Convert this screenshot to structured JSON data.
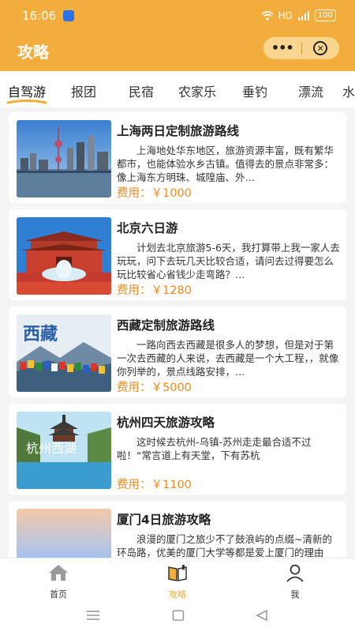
{
  "status_bar": {
    "time": "16:06",
    "network": "HD",
    "battery": "100"
  },
  "header": {
    "title": "攻略",
    "more_label": "•••"
  },
  "tabs": [
    {
      "label": "自驾游",
      "active": true
    },
    {
      "label": "报团",
      "active": false
    },
    {
      "label": "民宿",
      "active": false
    },
    {
      "label": "农家乐",
      "active": false
    },
    {
      "label": "垂钓",
      "active": false
    },
    {
      "label": "漂流",
      "active": false
    },
    {
      "label": "水",
      "active": false
    }
  ],
  "cards": [
    {
      "title": "上海两日定制旅游路线",
      "desc": "上海地处华东地区，旅游资源丰富，既有繁华都市，也能体验水乡古镇。值得去的景点非常多：像上海东方明珠、城隍庙、外…",
      "price": "费用：￥1000",
      "image": "shanghai-skyline"
    },
    {
      "title": "北京六日游",
      "desc": "计划去北京旅游5-6天，我打算带上我一家人去玩玩，问下去玩几天比较合适，请问去过得要怎么玩比较省心省钱少走弯路？…",
      "price": "费用：￥1280",
      "image": "beijing-tiananmen"
    },
    {
      "title": "西藏定制旅游路线",
      "desc": "一路向西去西藏是很多人的梦想，但是对于第一次去西藏的人来说，去西藏是一个大工程，，就像你列举的，景点线路安排，…",
      "price": "费用：￥5000",
      "image": "tibet-prayer-flags",
      "image_caption": "西藏"
    },
    {
      "title": "杭州四天旅游攻略",
      "desc": "这时候去杭州-乌镇-苏州走走最合适不过啦！“常言道上有天堂，下有苏杭",
      "price": "费用：￥1100",
      "image": "hangzhou-west-lake",
      "image_caption": "杭州西湖"
    },
    {
      "title": "厦门4日旅游攻略",
      "desc": "浪漫的厦门之旅少不了鼓浪屿的点缀~清新的环岛路，优美的厦门大学等都是爱上厦门的理由",
      "price": "",
      "image": "xiamen-sky"
    }
  ],
  "bottom_nav": [
    {
      "label": "首页",
      "icon": "home-icon",
      "active": false
    },
    {
      "label": "攻略",
      "icon": "book-icon",
      "active": true
    },
    {
      "label": "我",
      "icon": "person-icon",
      "active": false
    }
  ],
  "colors": {
    "accent": "#f2ad3c",
    "price": "#f08a1d",
    "brand_blue": "#2b72e6"
  }
}
